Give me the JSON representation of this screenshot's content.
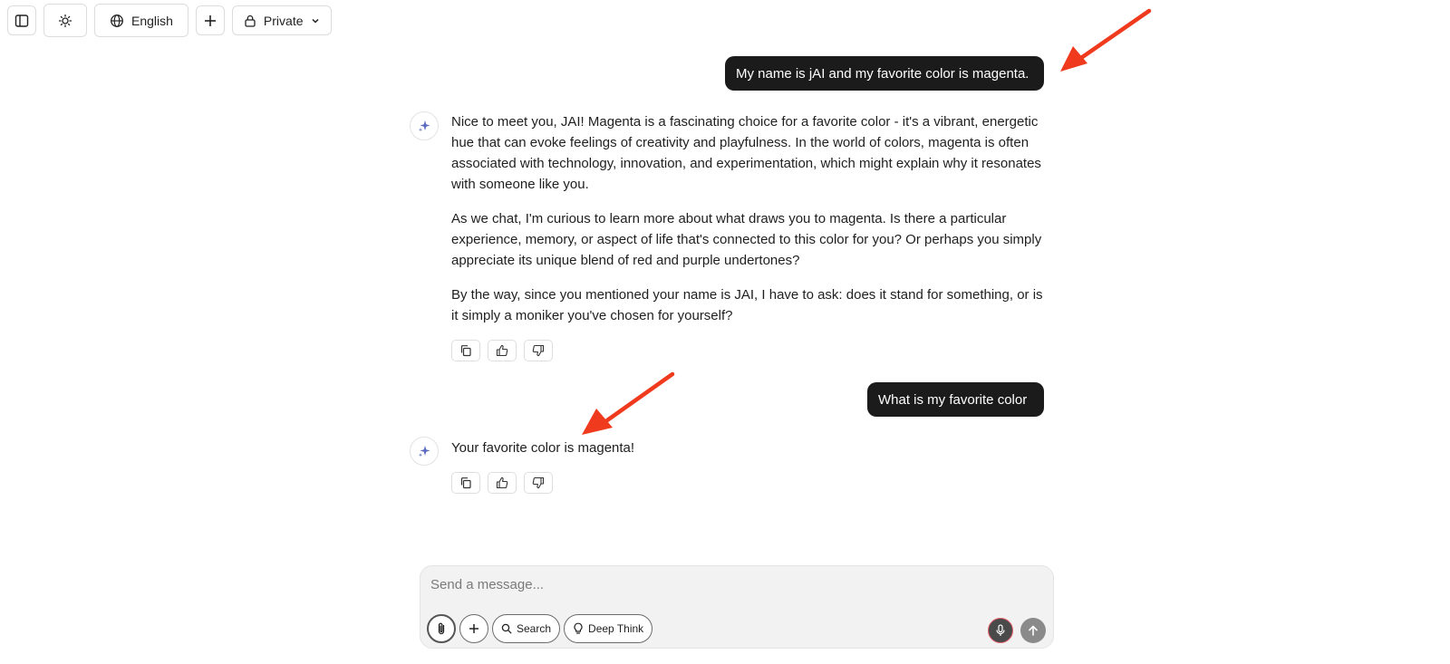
{
  "toolbar": {
    "language_label": "English",
    "privacy_label": "Private"
  },
  "messages": [
    {
      "role": "user",
      "text": "My name is jAI and my favorite color is magenta."
    },
    {
      "role": "assistant",
      "paragraphs": [
        "Nice to meet you, JAI! Magenta is a fascinating choice for a favorite color - it's a vibrant, energetic hue that can evoke feelings of creativity and playfulness. In the world of colors, magenta is often associated with technology, innovation, and experimentation, which might explain why it resonates with someone like you.",
        "As we chat, I'm curious to learn more about what draws you to magenta. Is there a particular experience, memory, or aspect of life that's connected to this color for you? Or perhaps you simply appreciate its unique blend of red and purple undertones?",
        "By the way, since you mentioned your name is JAI, I have to ask: does it stand for something, or is it simply a moniker you've chosen for yourself?"
      ]
    },
    {
      "role": "user",
      "text": "What is my favorite color"
    },
    {
      "role": "assistant",
      "paragraphs": [
        "Your favorite color is magenta!"
      ]
    }
  ],
  "composer": {
    "placeholder": "Send a message...",
    "search_label": "Search",
    "deep_think_label": "Deep Think"
  },
  "colors": {
    "user_bubble": "#1b1b1b",
    "annotation_arrow": "#f03a1e",
    "mic_ring": "#e05b6a"
  },
  "icons": [
    "sidebar-toggle-icon",
    "theme-sun-icon",
    "globe-icon",
    "plus-icon",
    "lock-icon",
    "chevron-down-icon",
    "sparkle-icon",
    "copy-icon",
    "thumbs-up-icon",
    "thumbs-down-icon",
    "paperclip-icon",
    "search-icon",
    "lightbulb-icon",
    "microphone-icon",
    "arrow-up-icon"
  ]
}
